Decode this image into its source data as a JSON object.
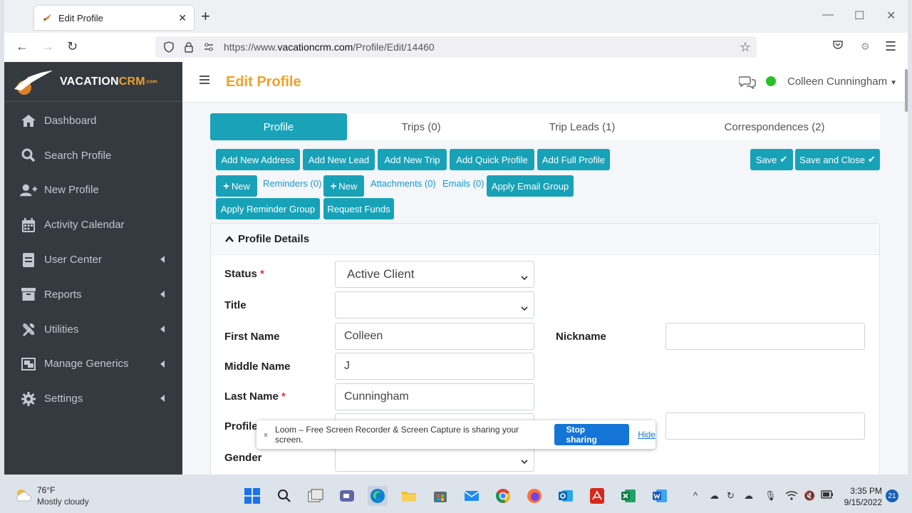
{
  "browser": {
    "tab_title": "Edit Profile",
    "url_prefix": "https://www.",
    "url_domain": "vacationcrm.com",
    "url_path": "/Profile/Edit/14460"
  },
  "brand": {
    "name_main": "VACATION",
    "name_accent": "CRM",
    "name_suffix": ".com",
    "accent_color": "#f0a12a"
  },
  "sidebar": {
    "items": [
      {
        "label": "Dashboard",
        "icon": "home-icon"
      },
      {
        "label": "Search Profile",
        "icon": "search-icon"
      },
      {
        "label": "New Profile",
        "icon": "user-plus-icon"
      },
      {
        "label": "Activity Calendar",
        "icon": "calendar-icon"
      },
      {
        "label": "User Center",
        "icon": "address-book-icon"
      },
      {
        "label": "Reports",
        "icon": "archive-icon"
      },
      {
        "label": "Utilities",
        "icon": "tools-icon"
      },
      {
        "label": "Manage Generics",
        "icon": "object-group-icon"
      },
      {
        "label": "Settings",
        "icon": "gear-icon"
      }
    ]
  },
  "header": {
    "title": "Edit Profile",
    "user_name": "Colleen Cunningham",
    "status_color": "#28c228"
  },
  "tabs": [
    {
      "label": "Profile"
    },
    {
      "label": "Trips (0)"
    },
    {
      "label": "Trip Leads (1)"
    },
    {
      "label": "Correspondences (2)"
    }
  ],
  "toolbar": {
    "add_new_address": "Add New Address",
    "add_new_lead": "Add New Lead",
    "add_new_trip": "Add New Trip",
    "add_quick_profile": "Add Quick Profile",
    "add_full_profile": "Add Full Profile",
    "save": "Save",
    "save_and_close": "Save and Close",
    "new_reminder": "New",
    "reminders": "Reminders (0)",
    "new_attachment": "New",
    "attachments": "Attachments (0)",
    "emails": "Emails (0)",
    "apply_email_group": "Apply Email Group",
    "apply_reminder_group": "Apply Reminder Group",
    "request_funds": "Request Funds"
  },
  "profile_details": {
    "header": "Profile Details",
    "status_label": "Status",
    "status_value": "Active Client",
    "title_label": "Title",
    "title_value": "",
    "first_name_label": "First Name",
    "first_name_value": "Colleen",
    "nickname_label": "Nickname",
    "nickname_value": "",
    "middle_name_label": "Middle Name",
    "middle_name_value": "J",
    "last_name_label": "Last Name",
    "last_name_value": "Cunningham",
    "profile_type_label": "Profile",
    "gender_label": "Gender"
  },
  "loom": {
    "message": "Loom – Free Screen Recorder & Screen Capture is sharing your screen.",
    "stop": "Stop sharing",
    "hide": "Hide"
  },
  "taskbar": {
    "temp": "76°F",
    "condition": "Mostly cloudy",
    "time": "3:35 PM",
    "date": "9/15/2022",
    "notifications": "21"
  }
}
